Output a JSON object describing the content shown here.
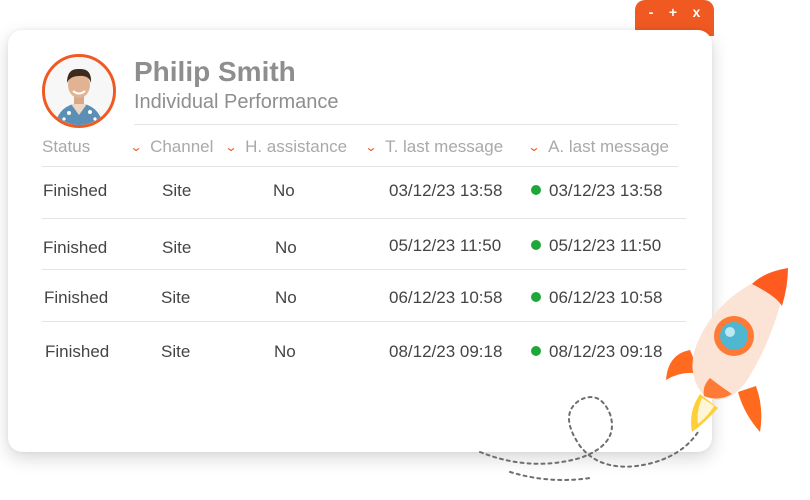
{
  "window_controls": {
    "minimize": "-",
    "maximize": "+",
    "close": "x"
  },
  "profile": {
    "name": "Philip Smith",
    "subtitle": "Individual Performance"
  },
  "table": {
    "columns": [
      "Status",
      "Channel",
      "H. assistance",
      "T. last message",
      "A. last message"
    ],
    "rows": [
      {
        "status": "Finished",
        "channel": "Site",
        "assistance": "No",
        "t_last": "03/12/23 13:58",
        "a_last": "03/12/23 13:58"
      },
      {
        "status": "Finished",
        "channel": "Site",
        "assistance": "No",
        "t_last": "05/12/23 11:50",
        "a_last": "05/12/23 11:50"
      },
      {
        "status": "Finished",
        "channel": "Site",
        "assistance": "No",
        "t_last": "06/12/23 10:58",
        "a_last": "06/12/23 10:58"
      },
      {
        "status": "Finished",
        "channel": "Site",
        "assistance": "No",
        "t_last": "08/12/23 09:18",
        "a_last": "08/12/23 09:18"
      }
    ]
  },
  "colors": {
    "accent": "#f05a22",
    "status_online": "#1fa83a",
    "muted_text": "#8e8e8e"
  },
  "icons": [
    "chevron-down-icon",
    "status-dot-icon",
    "rocket-icon"
  ]
}
